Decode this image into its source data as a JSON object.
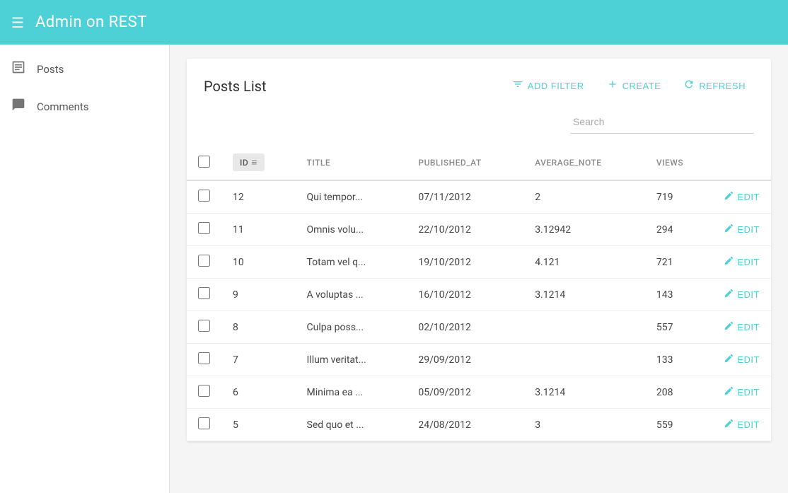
{
  "header": {
    "title": "Admin on REST",
    "menu_icon": "☰"
  },
  "sidebar": {
    "items": [
      {
        "id": "posts",
        "label": "Posts",
        "icon": "▣"
      },
      {
        "id": "comments",
        "label": "Comments",
        "icon": "💬"
      }
    ]
  },
  "main": {
    "page_title": "Posts List",
    "actions": {
      "add_filter": "ADD FILTER",
      "create": "CREATE",
      "refresh": "REFRESH"
    },
    "search": {
      "placeholder": "Search"
    },
    "table": {
      "columns": [
        {
          "key": "id",
          "label": "ID"
        },
        {
          "key": "title",
          "label": "TITLE"
        },
        {
          "key": "published_at",
          "label": "PUBLISHED_AT"
        },
        {
          "key": "average_note",
          "label": "AVERAGE_NOTE"
        },
        {
          "key": "views",
          "label": "VIEWS"
        }
      ],
      "rows": [
        {
          "id": "12",
          "title": "Qui tempor...",
          "published_at": "07/11/2012",
          "average_note": "2",
          "views": "719"
        },
        {
          "id": "11",
          "title": "Omnis volu...",
          "published_at": "22/10/2012",
          "average_note": "3.12942",
          "views": "294"
        },
        {
          "id": "10",
          "title": "Totam vel q...",
          "published_at": "19/10/2012",
          "average_note": "4.121",
          "views": "721"
        },
        {
          "id": "9",
          "title": "A voluptas ...",
          "published_at": "16/10/2012",
          "average_note": "3.1214",
          "views": "143"
        },
        {
          "id": "8",
          "title": "Culpa poss...",
          "published_at": "02/10/2012",
          "average_note": "",
          "views": "557"
        },
        {
          "id": "7",
          "title": "Illum veritat...",
          "published_at": "29/09/2012",
          "average_note": "",
          "views": "133"
        },
        {
          "id": "6",
          "title": "Minima ea ...",
          "published_at": "05/09/2012",
          "average_note": "3.1214",
          "views": "208"
        },
        {
          "id": "5",
          "title": "Sed quo et ...",
          "published_at": "24/08/2012",
          "average_note": "3",
          "views": "559"
        }
      ],
      "edit_label": "EDIT"
    }
  }
}
